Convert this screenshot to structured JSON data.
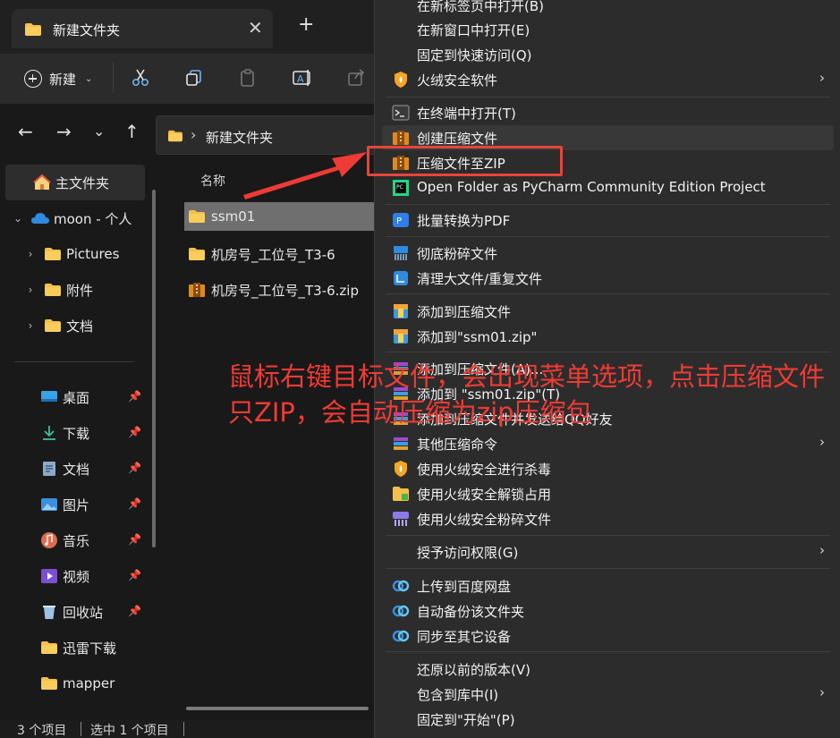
{
  "window": {
    "tab_title": "新建文件夹",
    "new_tab_symbol": "+",
    "close_symbol": "✕"
  },
  "toolbar": {
    "new_label": "新建"
  },
  "nav": {
    "back": "←",
    "forward": "→",
    "recent": "⌄",
    "up": "↑"
  },
  "address": {
    "path": "新建文件夹"
  },
  "sidebar": {
    "items": [
      {
        "label": "主文件夹",
        "icon": "home-icon"
      },
      {
        "label": "moon - 个人",
        "icon": "onedrive-cloud-icon"
      },
      {
        "label": "Pictures",
        "icon": "folder-icon"
      },
      {
        "label": "附件",
        "icon": "folder-icon"
      },
      {
        "label": "文档",
        "icon": "folder-icon"
      },
      {
        "label": "桌面",
        "icon": "desktop-icon"
      },
      {
        "label": "下载",
        "icon": "download-icon"
      },
      {
        "label": "文档",
        "icon": "documents-icon"
      },
      {
        "label": "图片",
        "icon": "pictures-icon"
      },
      {
        "label": "音乐",
        "icon": "music-icon"
      },
      {
        "label": "视频",
        "icon": "video-icon"
      },
      {
        "label": "回收站",
        "icon": "recycle-bin-icon"
      },
      {
        "label": "迅雷下载",
        "icon": "folder-icon"
      },
      {
        "label": "mapper",
        "icon": "folder-icon"
      }
    ]
  },
  "content": {
    "column_name": "名称",
    "files": [
      {
        "name": "ssm01",
        "icon": "folder-icon",
        "selected": true
      },
      {
        "name": "机房号_工位号_T3-6",
        "icon": "folder-icon",
        "selected": false
      },
      {
        "name": "机房号_工位号_T3-6.zip",
        "icon": "zip-archive-icon",
        "selected": false
      }
    ]
  },
  "statusbar": {
    "count": "3 个项目",
    "selected": "选中 1 个项目"
  },
  "context_menu": {
    "items": [
      {
        "label": "在新标签页中打开(B)"
      },
      {
        "label": "在新窗口中打开(E)"
      },
      {
        "label": "固定到快速访问(Q)"
      },
      {
        "label": "火绒安全软件",
        "icon": "huorong-shield-icon",
        "submenu": true
      },
      {
        "label": "在终端中打开(T)",
        "icon": "terminal-icon"
      },
      {
        "label": "创建压缩文件",
        "icon": "archive-icon"
      },
      {
        "label": "压缩文件至ZIP",
        "icon": "archive-icon"
      },
      {
        "label": "Open Folder as PyCharm Community Edition Project",
        "icon": "pycharm-icon"
      },
      {
        "label": "批量转换为PDF",
        "icon": "pdf-convert-icon"
      },
      {
        "label": "彻底粉碎文件",
        "icon": "shredder-icon"
      },
      {
        "label": "清理大文件/重复文件",
        "icon": "cleanup-icon"
      },
      {
        "label": "添加到压缩文件",
        "icon": "winrar-icon"
      },
      {
        "label": "添加到\"ssm01.zip\"",
        "icon": "winrar-icon"
      },
      {
        "label": "添加到压缩文件(A)...",
        "icon": "winrar-icon"
      },
      {
        "label": "添加到 \"ssm01.zip\"(T)",
        "icon": "winrar-icon"
      },
      {
        "label": "添加到压缩文件并发送给QQ好友",
        "icon": "winrar-icon"
      },
      {
        "label": "其他压缩命令",
        "icon": "winrar-icon",
        "submenu": true
      },
      {
        "label": "使用火绒安全进行杀毒",
        "icon": "huorong-shield-icon"
      },
      {
        "label": "使用火绒安全解锁占用",
        "icon": "unlock-folder-icon"
      },
      {
        "label": "使用火绒安全粉碎文件",
        "icon": "shred-purple-icon"
      },
      {
        "label": "授予访问权限(G)",
        "submenu": true
      },
      {
        "label": "上传到百度网盘",
        "icon": "baidu-netdisk-icon"
      },
      {
        "label": "自动备份该文件夹",
        "icon": "baidu-netdisk-icon"
      },
      {
        "label": "同步至其它设备",
        "icon": "baidu-netdisk-icon"
      },
      {
        "label": "还原以前的版本(V)"
      },
      {
        "label": "包含到库中(I)",
        "submenu": true
      },
      {
        "label": "固定到\"开始\"(P)"
      }
    ],
    "submenu_symbol": "›"
  },
  "annotation": {
    "text": "鼠标右键目标文件，会出现菜单选项，点击压缩文件只ZIP，会自动压缩为zip压缩包",
    "color": "#ef3b35"
  },
  "colors": {
    "folder": "#f4c04a",
    "highlight_red": "#e8443a",
    "menu_bg": "#2c2c2c"
  }
}
